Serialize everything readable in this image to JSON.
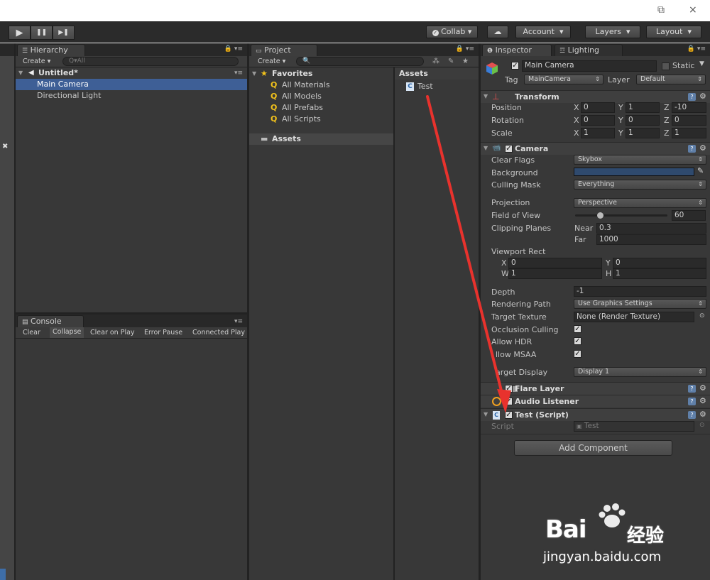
{
  "window": {
    "restore_glyph": "⧉",
    "close_glyph": "×"
  },
  "toolbar": {
    "play": "▶",
    "pause": "❚❚",
    "step": "▶❚",
    "collab": "Collab",
    "cloud": "☁",
    "account": "Account",
    "layers": "Layers",
    "layout": "Layout",
    "arrow": "▾"
  },
  "hierarchy": {
    "tab": "Hierarchy",
    "create": "Create",
    "search_placeholder": "Q▾All",
    "scene": "Untitled*",
    "items": [
      "Main Camera",
      "Directional Light"
    ]
  },
  "console": {
    "tab": "Console",
    "buttons": [
      "Clear",
      "Collapse",
      "Clear on Play",
      "Error Pause",
      "Connected Play"
    ]
  },
  "project": {
    "tab": "Project",
    "create": "Create",
    "favorites_label": "Favorites",
    "favorites": [
      "All Materials",
      "All Models",
      "All Prefabs",
      "All Scripts"
    ],
    "assets_folder": "Assets",
    "assets_header": "Assets",
    "asset_items": [
      "Test"
    ]
  },
  "inspector": {
    "tab_inspector": "Inspector",
    "tab_lighting": "Lighting",
    "object_name": "Main Camera",
    "static_label": "Static",
    "tag_label": "Tag",
    "tag_value": "MainCamera",
    "layer_label": "Layer",
    "layer_value": "Default",
    "transform": {
      "title": "Transform",
      "rows": [
        {
          "label": "Position",
          "x": "0",
          "y": "1",
          "z": "-10"
        },
        {
          "label": "Rotation",
          "x": "0",
          "y": "0",
          "z": "0"
        },
        {
          "label": "Scale",
          "x": "1",
          "y": "1",
          "z": "1"
        }
      ]
    },
    "camera": {
      "title": "Camera",
      "clear_flags_label": "Clear Flags",
      "clear_flags": "Skybox",
      "background_label": "Background",
      "background_color": "#2f4a6e",
      "culling_mask_label": "Culling Mask",
      "culling_mask": "Everything",
      "projection_label": "Projection",
      "projection": "Perspective",
      "fov_label": "Field of View",
      "fov": "60",
      "fov_fraction": 0.27,
      "clipping_label": "Clipping Planes",
      "near_label": "Near",
      "near": "0.3",
      "far_label": "Far",
      "far": "1000",
      "viewport_label": "Viewport Rect",
      "vx": "0",
      "vy": "0",
      "vw": "1",
      "vh": "1",
      "depth_label": "Depth",
      "depth": "-1",
      "rendering_path_label": "Rendering Path",
      "rendering_path": "Use Graphics Settings",
      "target_texture_label": "Target Texture",
      "target_texture": "None (Render Texture)",
      "occlusion_label": "Occlusion Culling",
      "hdr_label": "Allow HDR",
      "msaa_label": "llow MSAA",
      "target_display_label": "arget Display",
      "target_display": "Display 1"
    },
    "flare_layer": "Flare Layer",
    "audio_listener": "Audio Listener",
    "test_script": {
      "title": "Test (Script)",
      "script_label": "Script",
      "script_value": "Test"
    },
    "add_component": "Add Component",
    "axis_x": "X",
    "axis_y": "Y",
    "axis_z": "Z",
    "axis_w": "W",
    "axis_h": "H"
  },
  "watermark": {
    "brand": "Bai",
    "brand2": "经验",
    "url": "jingyan.baidu.com"
  },
  "colors": {
    "selection": "#3e5f96",
    "annotation_arrow": "#e8322d",
    "favorite_star": "#f2c21b"
  }
}
